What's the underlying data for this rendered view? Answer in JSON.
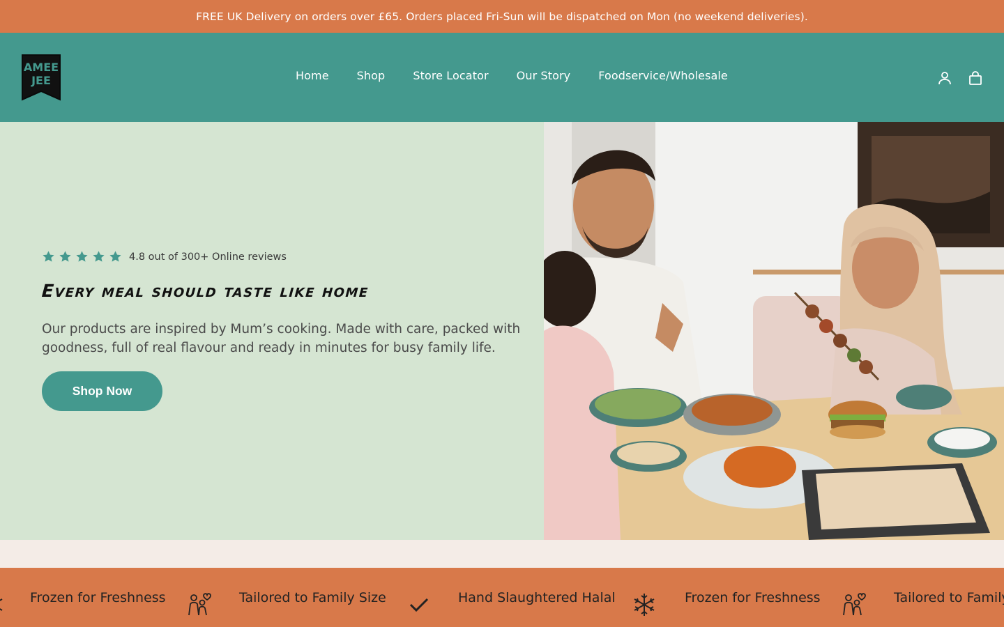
{
  "announcement": "FREE UK Delivery on orders over £65. Orders placed Fri-Sun will be dispatched on Mon (no weekend deliveries).",
  "brand": {
    "logo_line1": "AMEE",
    "logo_line2": "JEE",
    "logo_colors": {
      "badge": "#111111",
      "text": "#44998e"
    }
  },
  "nav": {
    "items": [
      "Home",
      "Shop",
      "Store Locator",
      "Our Story",
      "Foodservice/Wholesale"
    ]
  },
  "header_icons": [
    "account-icon",
    "cart-icon"
  ],
  "hero": {
    "rating_stars": 5,
    "rating_text": "4.8 out of 300+ Online reviews",
    "headline": "Every meal should taste like home",
    "description": "Our products are inspired by Mum’s cooking. Made with care, packed with goodness, full of real flavour and ready in minutes for busy family life.",
    "cta_label": "Shop Now",
    "image_alt": "Family enjoying a meal together at a dining table"
  },
  "features": [
    {
      "label": "Frozen for Freshness",
      "icon": "snowflake-icon"
    },
    {
      "label": "Tailored to Family Size",
      "icon": "family-icon"
    },
    {
      "label": "Hand Slaughtered Halal",
      "icon": "checkmark-icon"
    },
    {
      "label": "Frozen for Freshness",
      "icon": "snowflake-icon"
    },
    {
      "label": "Tailored to Family",
      "icon": "family-icon"
    }
  ],
  "colors": {
    "accent_orange": "#d8794a",
    "teal": "#44998e",
    "hero_bg": "#d5e5d2",
    "page_bg": "#f4ece7"
  }
}
